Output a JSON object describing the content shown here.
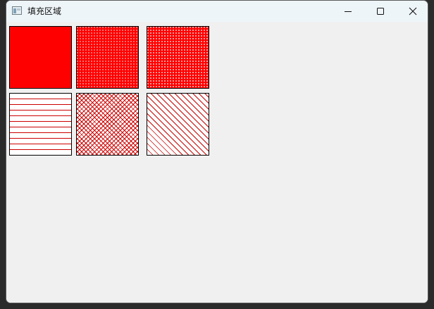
{
  "window": {
    "title": "填充区域"
  },
  "titlebar": {
    "icons": [
      "app-icon",
      "minimize-icon",
      "maximize-icon",
      "close-icon"
    ]
  },
  "swatches": [
    {
      "name": "solid-fill",
      "fill_color": "#ff0000",
      "pattern": "solid"
    },
    {
      "name": "fine-dot-fill",
      "fill_color": "#ff0000",
      "pattern": "dense-dots"
    },
    {
      "name": "dot-fill",
      "fill_color": "#ff0000",
      "pattern": "dots"
    },
    {
      "name": "horizontal-hatch-fill",
      "fill_color": "#cc0000",
      "pattern": "horizontal-lines"
    },
    {
      "name": "cross-hatch-fill",
      "fill_color": "#cc0000",
      "pattern": "diagonal-cross"
    },
    {
      "name": "diagonal-hatch-fill",
      "fill_color": "#cc0000",
      "pattern": "diagonal-lines"
    }
  ]
}
